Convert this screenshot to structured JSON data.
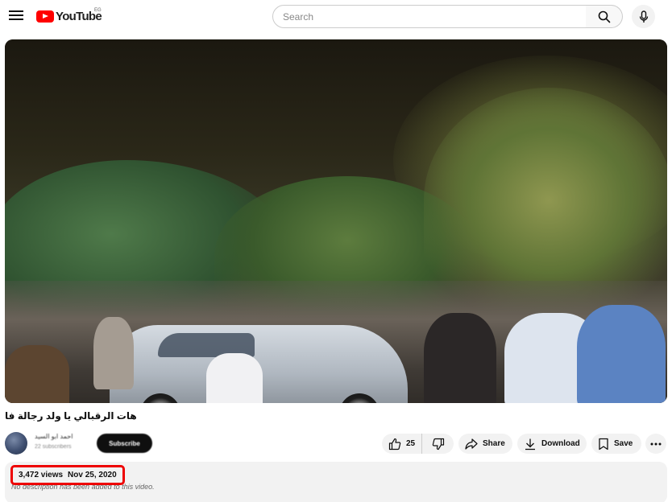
{
  "header": {
    "logo_text": "YouTube",
    "country_code": "EG",
    "search_placeholder": "Search"
  },
  "video": {
    "title": "هات الرقبالي يا ولد رجالة فا",
    "channel_name": "احمد ابو السيد",
    "subscriber_count": "22 subscribers",
    "subscribe_label": "Subscribe"
  },
  "actions": {
    "likes": "25",
    "share_label": "Share",
    "download_label": "Download",
    "save_label": "Save"
  },
  "description": {
    "views": "3,472 views",
    "date": "Nov 25, 2020",
    "text": "No description has been added to this video."
  },
  "colors": {
    "brand_red": "#ff0000",
    "highlight_box": "#ee0000",
    "pill_bg": "#f2f2f2"
  }
}
